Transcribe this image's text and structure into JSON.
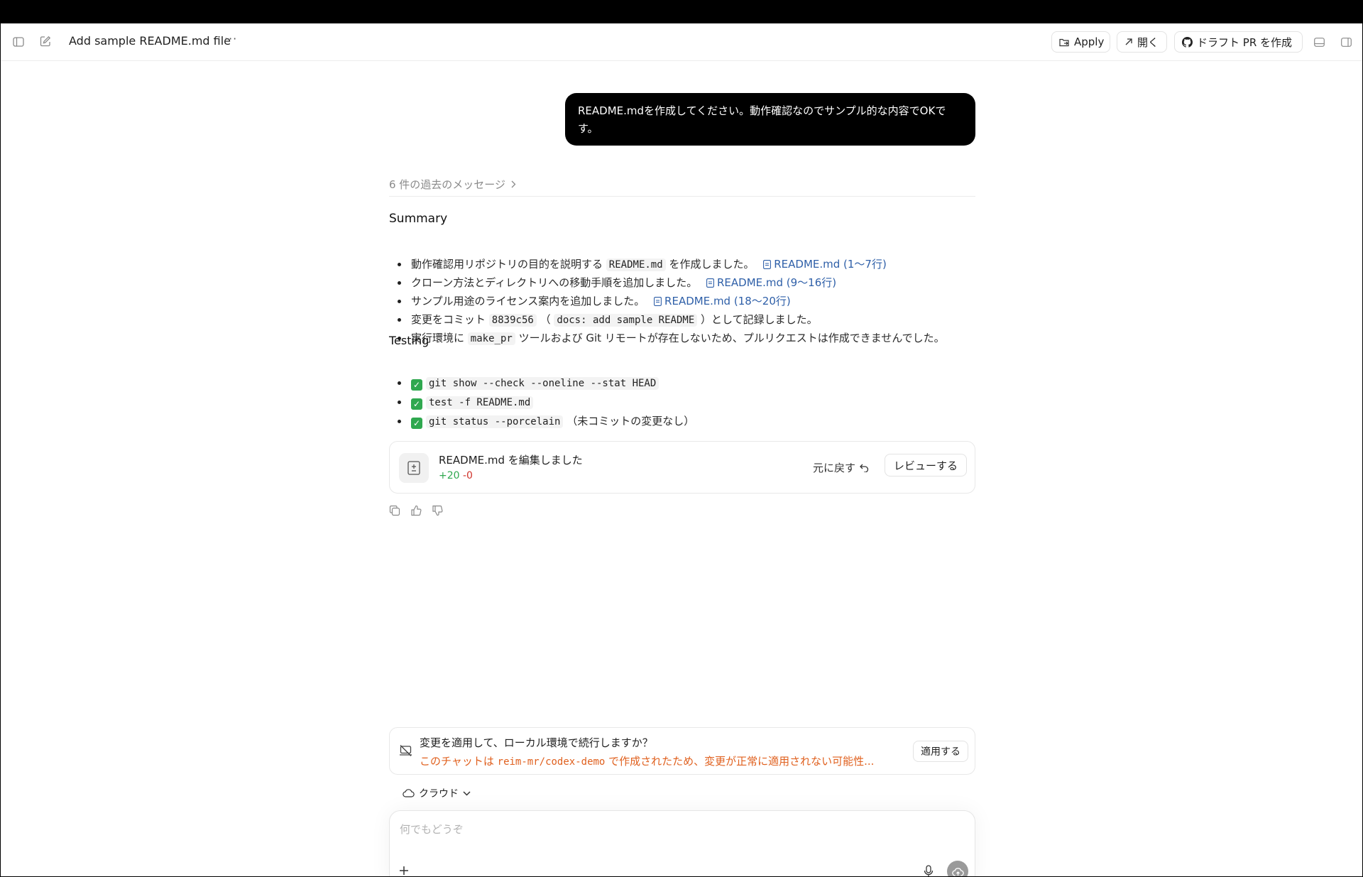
{
  "topbar": {
    "title": "Add sample README.md file",
    "more": "···",
    "apply_label": "Apply",
    "open_label": "開く",
    "draft_pr_label": "ドラフト PR を作成"
  },
  "chat": {
    "user_message": "README.mdを作成してください。動作確認なのでサンプル的な内容でOKです。",
    "past_messages_label": "6 件の過去のメッセージ",
    "summary_heading": "Summary",
    "summary": [
      {
        "before": "動作確認用リポジトリの目的を説明する",
        "code": "README.md",
        "after": "を作成しました。",
        "link": "README.md (1〜7行)"
      },
      {
        "before": "クローン方法とディレクトリへの移動手順を追加しました。",
        "link": "README.md (9〜16行)"
      },
      {
        "before": "サンプル用途のライセンス案内を追加しました。",
        "link": "README.md (18〜20行)"
      },
      {
        "before": "変更をコミット",
        "code": "8839c56",
        "mid": "（",
        "code2": "docs: add sample README",
        "after": "）として記録しました。"
      },
      {
        "before": "実行環境に",
        "code": "make_pr",
        "after": "ツールおよび Git リモートが存在しないため、プルリクエストは作成できませんでした。"
      }
    ],
    "testing_heading": "Testing",
    "testing": [
      {
        "check": "✓",
        "code": "git show --check --oneline --stat HEAD",
        "after": ""
      },
      {
        "check": "✓",
        "code": "test -f README.md",
        "after": ""
      },
      {
        "check": "✓",
        "code": "git status --porcelain",
        "after": "（未コミットの変更なし）"
      }
    ]
  },
  "edit_card": {
    "title": "README.md を編集しました",
    "additions": "+20",
    "deletions": "-0",
    "undo_label": "元に戻す",
    "review_label": "レビューする"
  },
  "apply_card": {
    "question": "変更を適用して、ローカル環境で続行しますか？",
    "warning_before": "このチャットは",
    "warning_repo": "reim-mr/codex-demo",
    "warning_after": "で作成されたため、変更が正常に適用されない可能性...",
    "apply_button": "適用する"
  },
  "environment": {
    "label": "クラウド"
  },
  "composer": {
    "placeholder": "何でもどうぞ"
  },
  "colors": {
    "accent_link": "#2e5fa8",
    "additions": "#2fa84f",
    "deletions": "#d0342c",
    "warning": "#e0601e"
  }
}
